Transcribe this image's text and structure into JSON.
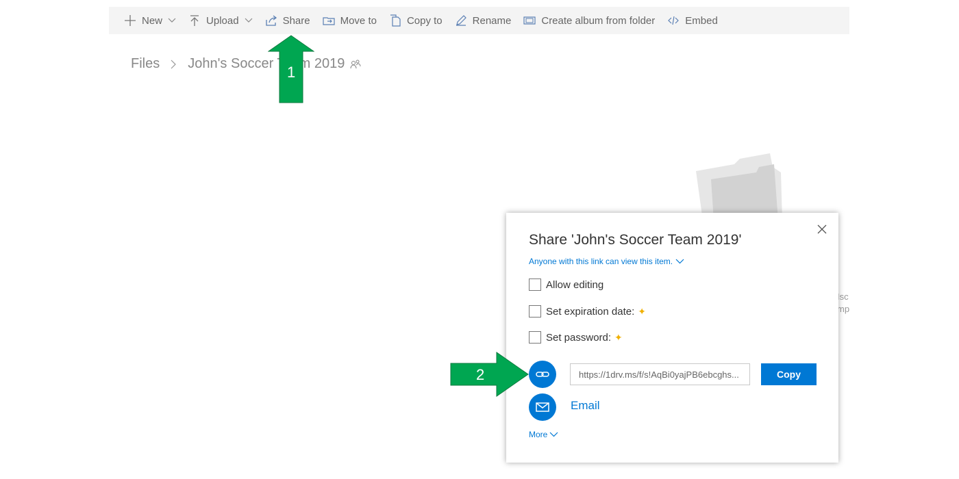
{
  "toolbar": {
    "new_label": "New",
    "upload_label": "Upload",
    "share_label": "Share",
    "move_label": "Move to",
    "copy_label": "Copy to",
    "rename_label": "Rename",
    "album_label": "Create album from folder",
    "embed_label": "Embed"
  },
  "breadcrumb": {
    "root": "Files",
    "current": "John's Soccer Team 2019"
  },
  "annotations": {
    "step1": "1",
    "step2": "2"
  },
  "background": {
    "line1": "Isc",
    "line2": "mp"
  },
  "dialog": {
    "title": "Share 'John's Soccer Team 2019'",
    "permission_text": "Anyone with this link can view this item.",
    "options": {
      "allow_editing": "Allow editing",
      "expiration": "Set expiration date:",
      "password": "Set password:"
    },
    "premium_star": "✦",
    "link_value": "https://1drv.ms/f/s!AqBi0yajPB6ebcghs...",
    "copy_label": "Copy",
    "email_label": "Email",
    "more_label": "More"
  },
  "colors": {
    "accent": "#0078d4",
    "arrow_green": "#00a651",
    "toolbar_bg": "#f4f4f4",
    "premium_star": "#f0b000"
  }
}
